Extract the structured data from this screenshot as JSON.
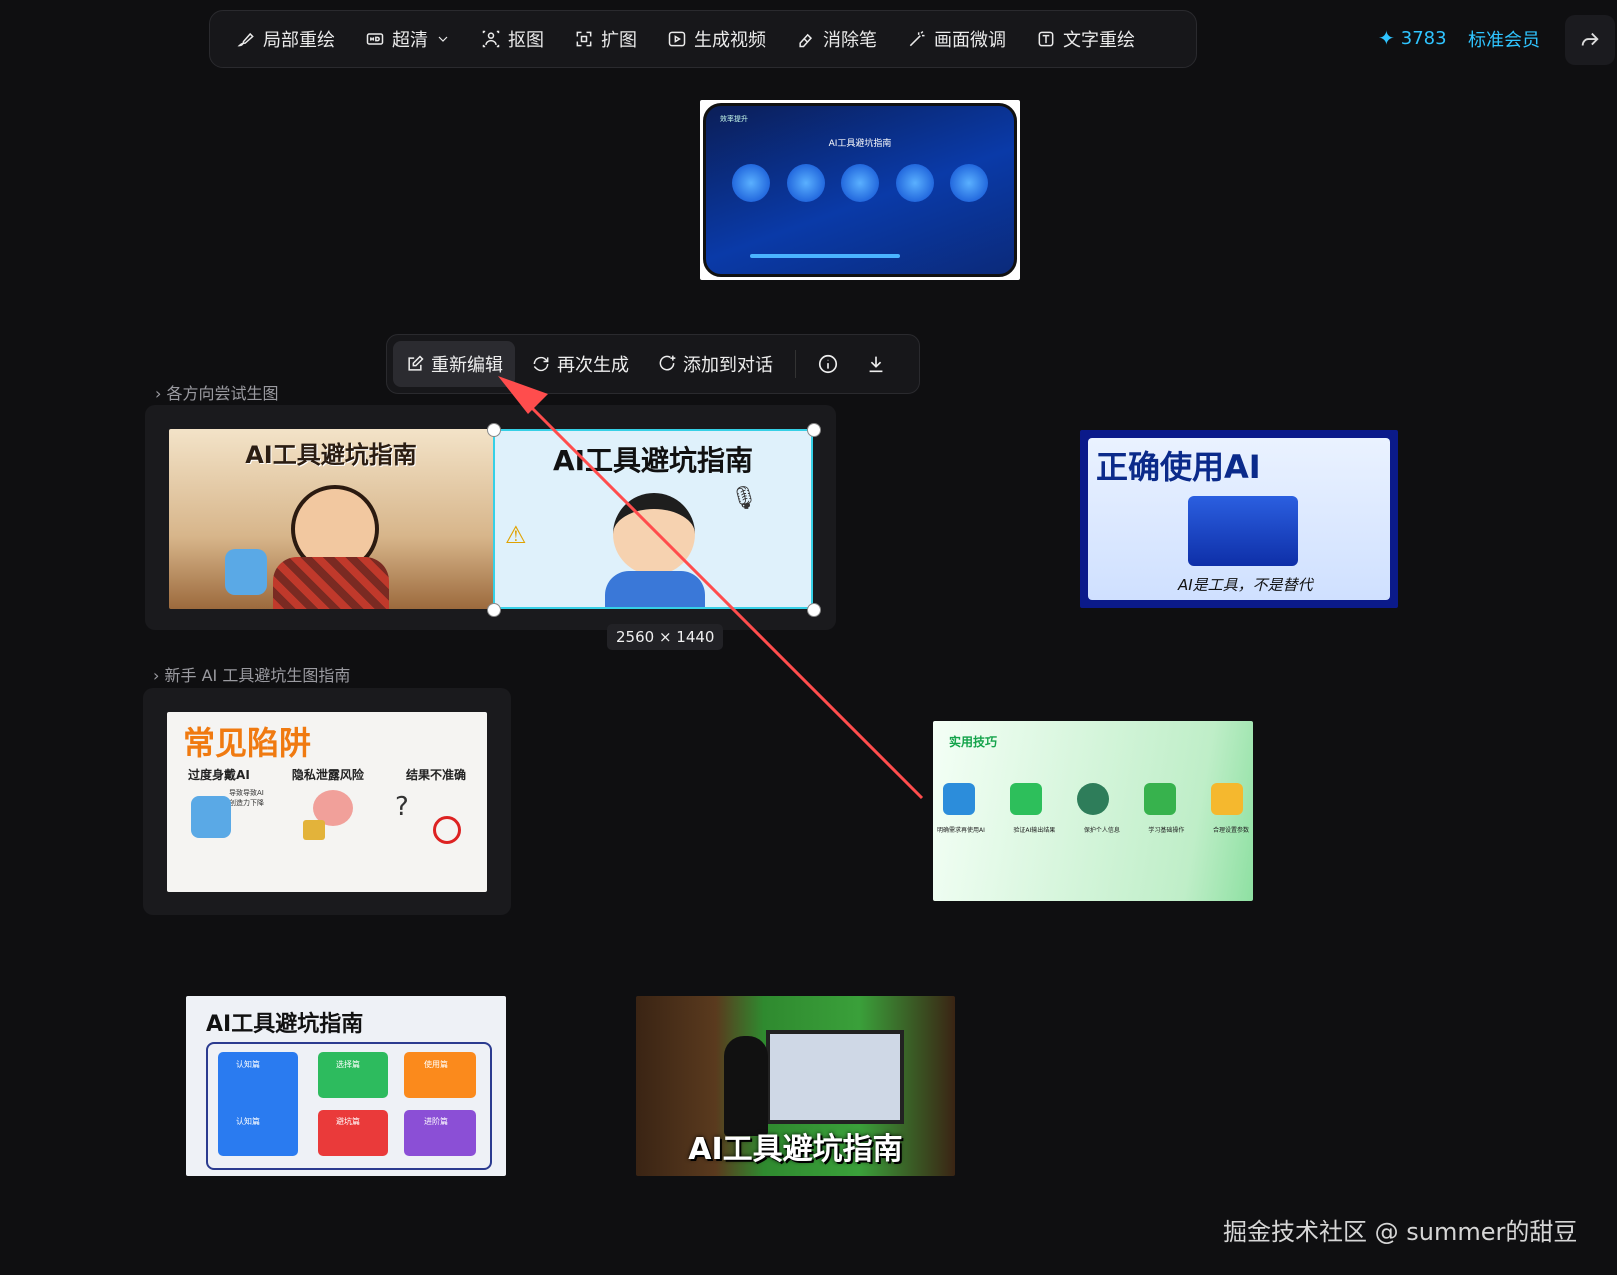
{
  "toolbar": {
    "items": [
      {
        "label": "局部重绘",
        "icon": "brush-icon"
      },
      {
        "label": "超清",
        "icon": "hd-icon",
        "dropdown": true
      },
      {
        "label": "抠图",
        "icon": "cutout-person-icon"
      },
      {
        "label": "扩图",
        "icon": "expand-icon"
      },
      {
        "label": "生成视频",
        "icon": "play-icon"
      },
      {
        "label": "消除笔",
        "icon": "eraser-icon"
      },
      {
        "label": "画面微调",
        "icon": "magic-wand-icon"
      },
      {
        "label": "文字重绘",
        "icon": "text-box-icon"
      }
    ]
  },
  "account": {
    "credits": "3783",
    "membership": "标准会员"
  },
  "actionbar": {
    "reedit": "重新编辑",
    "regenerate": "再次生成",
    "add_to_chat": "添加到对话"
  },
  "groups": {
    "group1_label": "各方向尝试生图",
    "group2_label": "新手 AI 工具避坑生图指南"
  },
  "selection": {
    "dimensions": "2560 × 1440"
  },
  "images": {
    "phone_title": "AI工具避坑指南",
    "phone_app": "效率提升",
    "cartoon1_title": "AI工具避坑指南",
    "cartoon2_title": "AI工具避坑指南",
    "scale_title": "正确使用AI",
    "scale_caption": "AI是工具，不是替代",
    "pitfalls": {
      "title": "常见陷阱",
      "cols": [
        "过度身戴AI",
        "隐私泄露风险",
        "结果不准确"
      ],
      "sub": "导致导致AI 创造力下降"
    },
    "tips": {
      "title": "实用技巧",
      "items": [
        "明确需求再使用AI",
        "验证AI输出结果",
        "保护个人信息",
        "学习基础操作",
        "合理设置参数"
      ]
    },
    "flow": {
      "title": "AI工具避坑指南",
      "boxes": [
        "认知篇",
        "选择篇",
        "使用篇",
        "认知篇",
        "避坑篇",
        "进阶篇"
      ]
    },
    "studio_title": "AI工具避坑指南"
  },
  "watermark": "掘金技术社区 @ summer的甜豆",
  "colors": {
    "accent": "#2fc4ff",
    "arrow": "#ff4d4d",
    "selection": "#36d0e6"
  }
}
